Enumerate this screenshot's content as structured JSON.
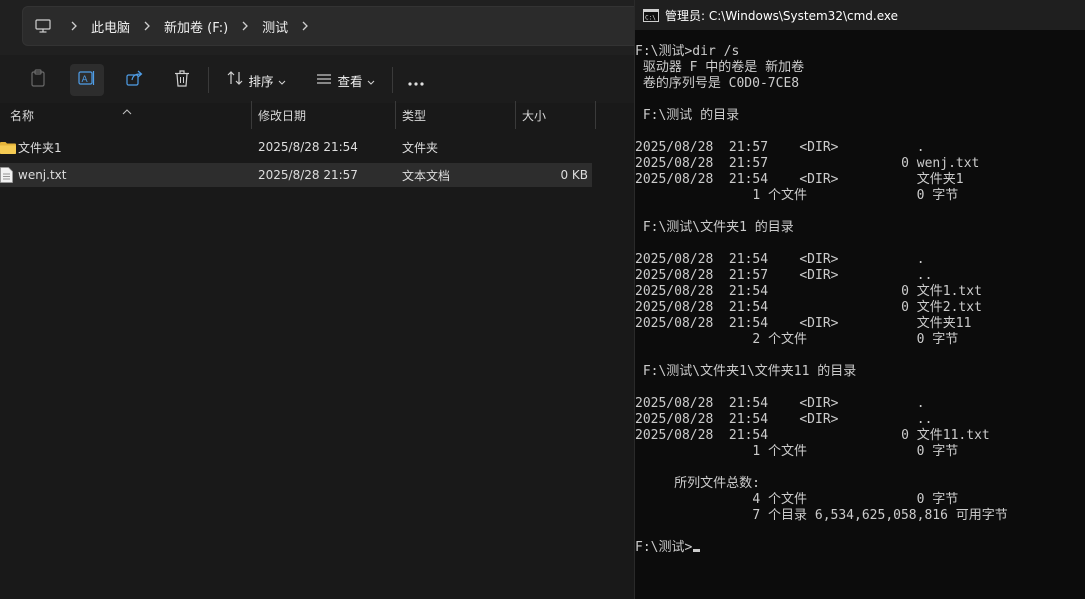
{
  "explorer": {
    "breadcrumb": [
      "此电脑",
      "新加卷 (F:)",
      "测试"
    ],
    "toolbar": {
      "sort_label": "排序",
      "view_label": "查看"
    },
    "columns": [
      "名称",
      "修改日期",
      "类型",
      "大小"
    ],
    "rows": [
      {
        "name": "文件夹1",
        "date": "2025/8/28 21:54",
        "type": "文件夹",
        "size": ""
      },
      {
        "name": "wenj.txt",
        "date": "2025/8/28 21:57",
        "type": "文本文档",
        "size": "0 KB"
      }
    ]
  },
  "cmd": {
    "title": "管理员: C:\\Windows\\System32\\cmd.exe",
    "lines": [
      "F:\\测试>dir /s",
      " 驱动器 F 中的卷是 新加卷",
      " 卷的序列号是 C0D0-7CE8",
      "",
      " F:\\测试 的目录",
      "",
      "2025/08/28  21:57    <DIR>          .",
      "2025/08/28  21:57                 0 wenj.txt",
      "2025/08/28  21:54    <DIR>          文件夹1",
      "               1 个文件              0 字节",
      "",
      " F:\\测试\\文件夹1 的目录",
      "",
      "2025/08/28  21:54    <DIR>          .",
      "2025/08/28  21:57    <DIR>          ..",
      "2025/08/28  21:54                 0 文件1.txt",
      "2025/08/28  21:54                 0 文件2.txt",
      "2025/08/28  21:54    <DIR>          文件夹11",
      "               2 个文件              0 字节",
      "",
      " F:\\测试\\文件夹1\\文件夹11 的目录",
      "",
      "2025/08/28  21:54    <DIR>          .",
      "2025/08/28  21:54    <DIR>          ..",
      "2025/08/28  21:54                 0 文件11.txt",
      "               1 个文件              0 字节",
      "",
      "     所列文件总数:",
      "               4 个文件              0 字节",
      "               7 个目录 6,534,625,058,816 可用字节",
      "",
      "F:\\测试>"
    ]
  }
}
